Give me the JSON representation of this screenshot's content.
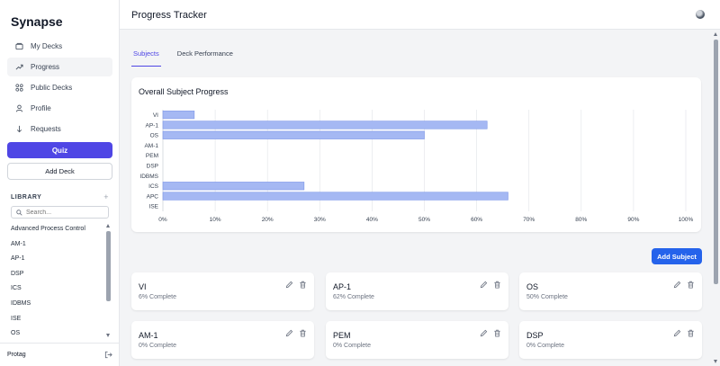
{
  "sidebar": {
    "brand": "Synapse",
    "nav": [
      {
        "label": "My Decks",
        "icon": "deck-icon"
      },
      {
        "label": "Progress",
        "icon": "trending-up-icon"
      },
      {
        "label": "Public Decks",
        "icon": "grid-icon"
      },
      {
        "label": "Profile",
        "icon": "user-icon"
      },
      {
        "label": "Requests",
        "icon": "arrow-down-icon"
      }
    ],
    "active_nav": "Progress",
    "quiz_label": "Quiz",
    "add_deck_label": "Add Deck",
    "library_label": "LIBRARY",
    "library_add": "+",
    "search_placeholder": "Search...",
    "library_items": [
      "Advanced Process Control",
      "AM-1",
      "AP-1",
      "DSP",
      "ICS",
      "IDBMS",
      "ISE",
      "OS"
    ],
    "user_name": "Protag"
  },
  "header": {
    "title": "Progress Tracker"
  },
  "tabs": [
    {
      "label": "Subjects"
    },
    {
      "label": "Deck Performance"
    }
  ],
  "active_tab": "Subjects",
  "chart_title": "Overall Subject Progress",
  "chart_data": {
    "type": "bar",
    "orientation": "horizontal",
    "title": "Overall Subject Progress",
    "categories": [
      "VI",
      "AP-1",
      "OS",
      "AM-1",
      "PEM",
      "DSP",
      "IDBMS",
      "ICS",
      "APC",
      "ISE"
    ],
    "values": [
      6,
      62,
      50,
      0,
      0,
      0,
      0,
      27,
      66,
      0
    ],
    "xlim": [
      0,
      100
    ],
    "ticks": [
      "0%",
      "10%",
      "20%",
      "30%",
      "40%",
      "50%",
      "60%",
      "70%",
      "80%",
      "90%",
      "100%"
    ],
    "grid": true,
    "bar_color": "#a5b8f3",
    "bar_stroke": "#7b95e8"
  },
  "add_subject_label": "Add Subject",
  "subjects": [
    {
      "name": "VI",
      "status": "6% Complete"
    },
    {
      "name": "AP-1",
      "status": "62% Complete"
    },
    {
      "name": "OS",
      "status": "50% Complete"
    },
    {
      "name": "AM-1",
      "status": "0% Complete"
    },
    {
      "name": "PEM",
      "status": "0% Complete"
    },
    {
      "name": "DSP",
      "status": "0% Complete"
    }
  ],
  "colors": {
    "accent": "#4f46e5",
    "primary_button": "#2563eb"
  }
}
